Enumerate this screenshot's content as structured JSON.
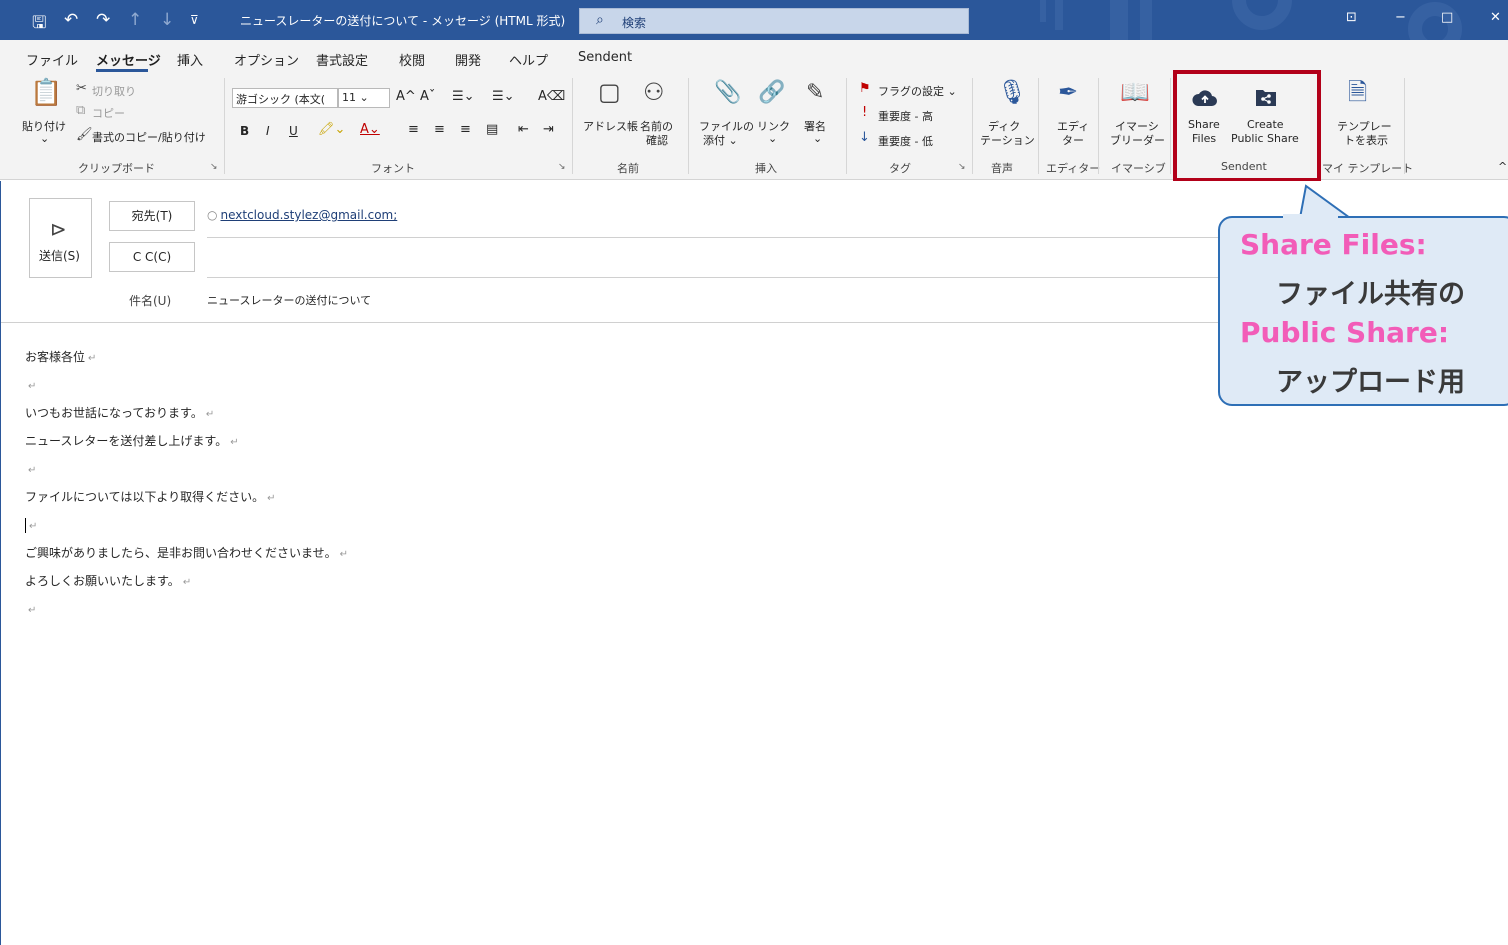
{
  "window": {
    "title": "ニュースレーターの送付について - メッセージ (HTML 形式)",
    "search_placeholder": "検索"
  },
  "qat": {
    "save": "🖫",
    "undo": "↶",
    "redo": "↷",
    "up": "↑",
    "down": "↓",
    "more": "⊽"
  },
  "window_controls": {
    "restore_ribbon": "⊡",
    "minimize": "−",
    "maximize": "□",
    "close": "✕"
  },
  "menu_tabs": [
    "ファイル",
    "メッセージ",
    "挿入",
    "オプション",
    "書式設定",
    "校閲",
    "開発",
    "ヘルプ",
    "Sendent"
  ],
  "active_tab": "メッセージ",
  "ribbon": {
    "clipboard": {
      "paste": "貼り付け",
      "paste_arrow": "⌄",
      "cut": "切り取り",
      "copy": "コピー",
      "format_painter": "書式のコピー/貼り付け",
      "group": "クリップボード"
    },
    "font": {
      "font_name": "游ゴシック (本文(",
      "font_size": "11",
      "grow": "A^",
      "shrink": "Aˇ",
      "bold": "B",
      "italic": "I",
      "underline": "U",
      "group": "フォント"
    },
    "names": {
      "address_book": "アドレス帳",
      "check_names_1": "名前の",
      "check_names_2": "確認",
      "group": "名前"
    },
    "insert": {
      "attach_1": "ファイルの",
      "attach_2": "添付 ⌄",
      "link_1": "リンク",
      "link_2": "⌄",
      "signature_1": "署名",
      "signature_2": "⌄",
      "group": "挿入"
    },
    "tags": {
      "flag": "フラグの設定 ⌄",
      "high": "重要度 - 高",
      "low": "重要度 - 低",
      "group": "タグ"
    },
    "voice": {
      "dictate_1": "ディク",
      "dictate_2": "テーション",
      "group": "音声"
    },
    "editor": {
      "editor_1": "エディ",
      "editor_2": "ター",
      "group": "エディター"
    },
    "immersive": {
      "reader_1": "イマーシ",
      "reader_2": "ブリーダー",
      "group": "イマーシブ"
    },
    "sendent": {
      "share_1": "Share",
      "share_2": "Files",
      "public_1": "Create",
      "public_2": "Public Share",
      "group": "Sendent"
    },
    "templates": {
      "view_1": "テンプレー",
      "view_2": "トを表示",
      "group": "マイ テンプレート"
    }
  },
  "compose": {
    "send": "送信(S)",
    "to_button": "宛先(T)",
    "cc_button": "C C(C)",
    "to_value": "nextcloud.stylez@gmail.com;",
    "subject_label": "件名(U)",
    "subject_value": "ニュースレーターの送付について",
    "body_lines": [
      "お客様各位",
      "",
      "いつもお世話になっております。",
      "ニュースレターを送付差し上げます。",
      "",
      "ファイルについては以下より取得ください。",
      "",
      "ご興味がありましたら、是非お問い合わせくださいませ。",
      "よろしくお願いいたします。",
      ""
    ],
    "paragraph_mark": "↵"
  },
  "callout": {
    "line1": "Share Files:",
    "line2": "ファイル共有の",
    "line3": "Public Share:",
    "line4": "アップロード用"
  },
  "colors": {
    "titlebar": "#2b579a",
    "highlight": "#b20019",
    "callout_title": "#f25cb8",
    "callout_border": "#2e6fb6"
  }
}
